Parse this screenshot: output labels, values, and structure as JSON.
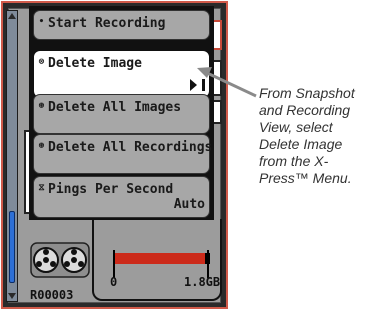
{
  "menu": {
    "items": [
      {
        "label": "Start Recording",
        "bullet": "•"
      },
      {
        "label": "Delete Image",
        "bullet": "⊗",
        "selected": true
      },
      {
        "label": "Delete All Images",
        "bullet": "⊛"
      },
      {
        "label": "Delete All Recordings",
        "bullet": "⊛"
      },
      {
        "label": "Pings Per Second",
        "bullet": "⧖",
        "value": "Auto"
      }
    ]
  },
  "status": {
    "recording_id": "R00003",
    "storage_min": "0",
    "storage_max": "1.8GB",
    "storage_used_fraction": 0.95
  },
  "callout": {
    "text": "From Snapshot and Recording View, select Delete Image from the X-Press™ Menu."
  },
  "colors": {
    "screen_border": "#d05a4a",
    "menu_bg": "#a7a7a7",
    "selected_bg": "#ffffff",
    "scroll_thumb": "#2d6fd6",
    "storage_fill": "#cc2a1a"
  }
}
